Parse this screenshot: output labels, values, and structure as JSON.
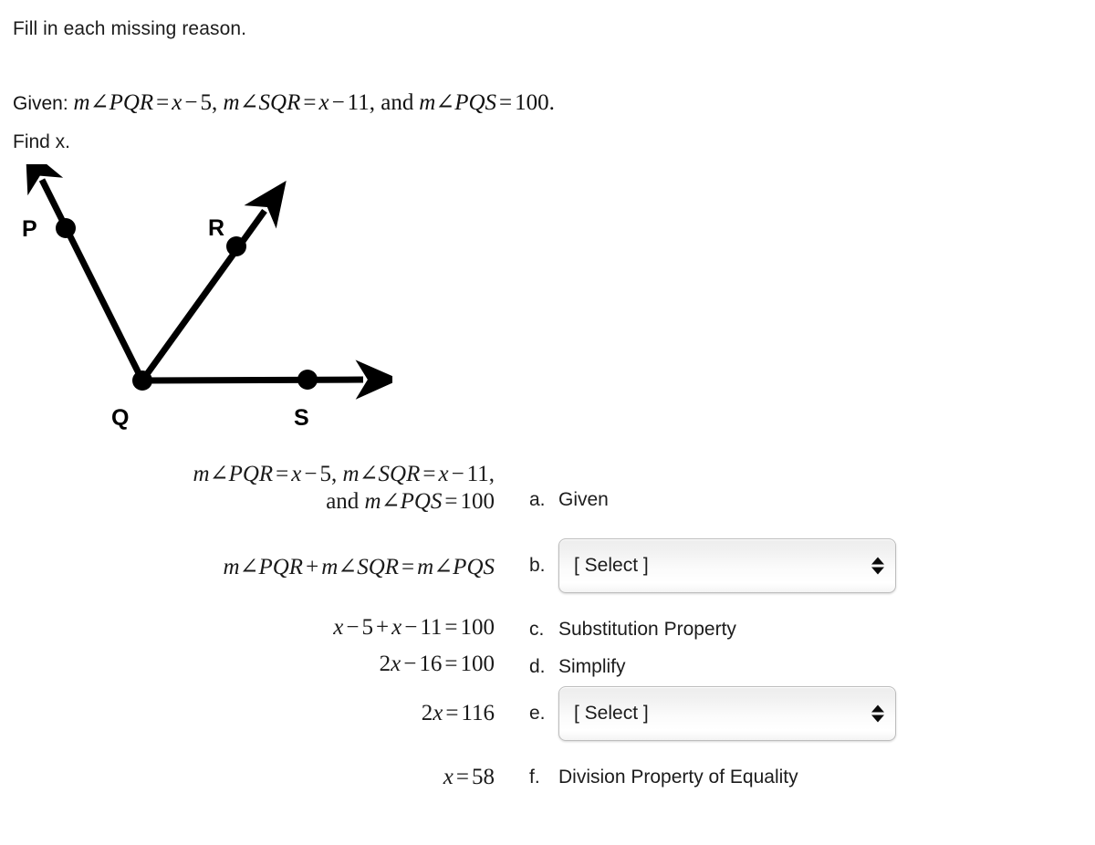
{
  "instruction": "Fill in each missing reason.",
  "given": {
    "prefix": "Given:",
    "expr1_lhs": "m∠PQR",
    "expr1_rhs": "x − 5",
    "expr2_lhs": "m∠SQR",
    "expr2_rhs": "x − 11",
    "conj": "and",
    "expr3_lhs": "m∠PQS",
    "expr3_rhs": "100",
    "full": "Given: m∠PQR = x − 5, m∠SQR = x − 11, and m∠PQS = 100.",
    "find": "Find x."
  },
  "figure": {
    "type": "angle-diagram",
    "vertex_label": "Q",
    "points": [
      {
        "name": "P",
        "label": "P"
      },
      {
        "name": "R",
        "label": "R"
      },
      {
        "name": "Q",
        "label": "Q"
      },
      {
        "name": "S",
        "label": "S"
      }
    ],
    "rays": [
      "QP",
      "QR",
      "QS"
    ],
    "stroke_color": "#000000"
  },
  "proof": {
    "statements": [
      {
        "id": "a",
        "line1": "m∠PQR = x − 5,  m∠SQR = x − 11,",
        "line2": "and m∠PQS = 100"
      },
      {
        "id": "b",
        "line1": "m∠PQR + m∠SQR = m∠PQS",
        "line2": ""
      },
      {
        "id": "c",
        "line1": "x − 5 + x − 11 = 100",
        "line2": ""
      },
      {
        "id": "d",
        "line1": "2x − 16 = 100",
        "line2": ""
      },
      {
        "id": "e",
        "line1": "2x = 116",
        "line2": ""
      },
      {
        "id": "f",
        "line1": "x = 58",
        "line2": ""
      }
    ],
    "reasons": [
      {
        "letter": "a.",
        "kind": "text",
        "text": "Given"
      },
      {
        "letter": "b.",
        "kind": "select",
        "text": "[ Select ]"
      },
      {
        "letter": "c.",
        "kind": "text",
        "text": "Substitution Property"
      },
      {
        "letter": "d.",
        "kind": "text",
        "text": "Simplify"
      },
      {
        "letter": "e.",
        "kind": "select",
        "text": "[ Select ]"
      },
      {
        "letter": "f.",
        "kind": "text",
        "text": "Division Property of Equality"
      }
    ]
  },
  "colors": {
    "text": "#1c1c1c",
    "figure_stroke": "#000000",
    "select_border": "#bdbdbd"
  }
}
